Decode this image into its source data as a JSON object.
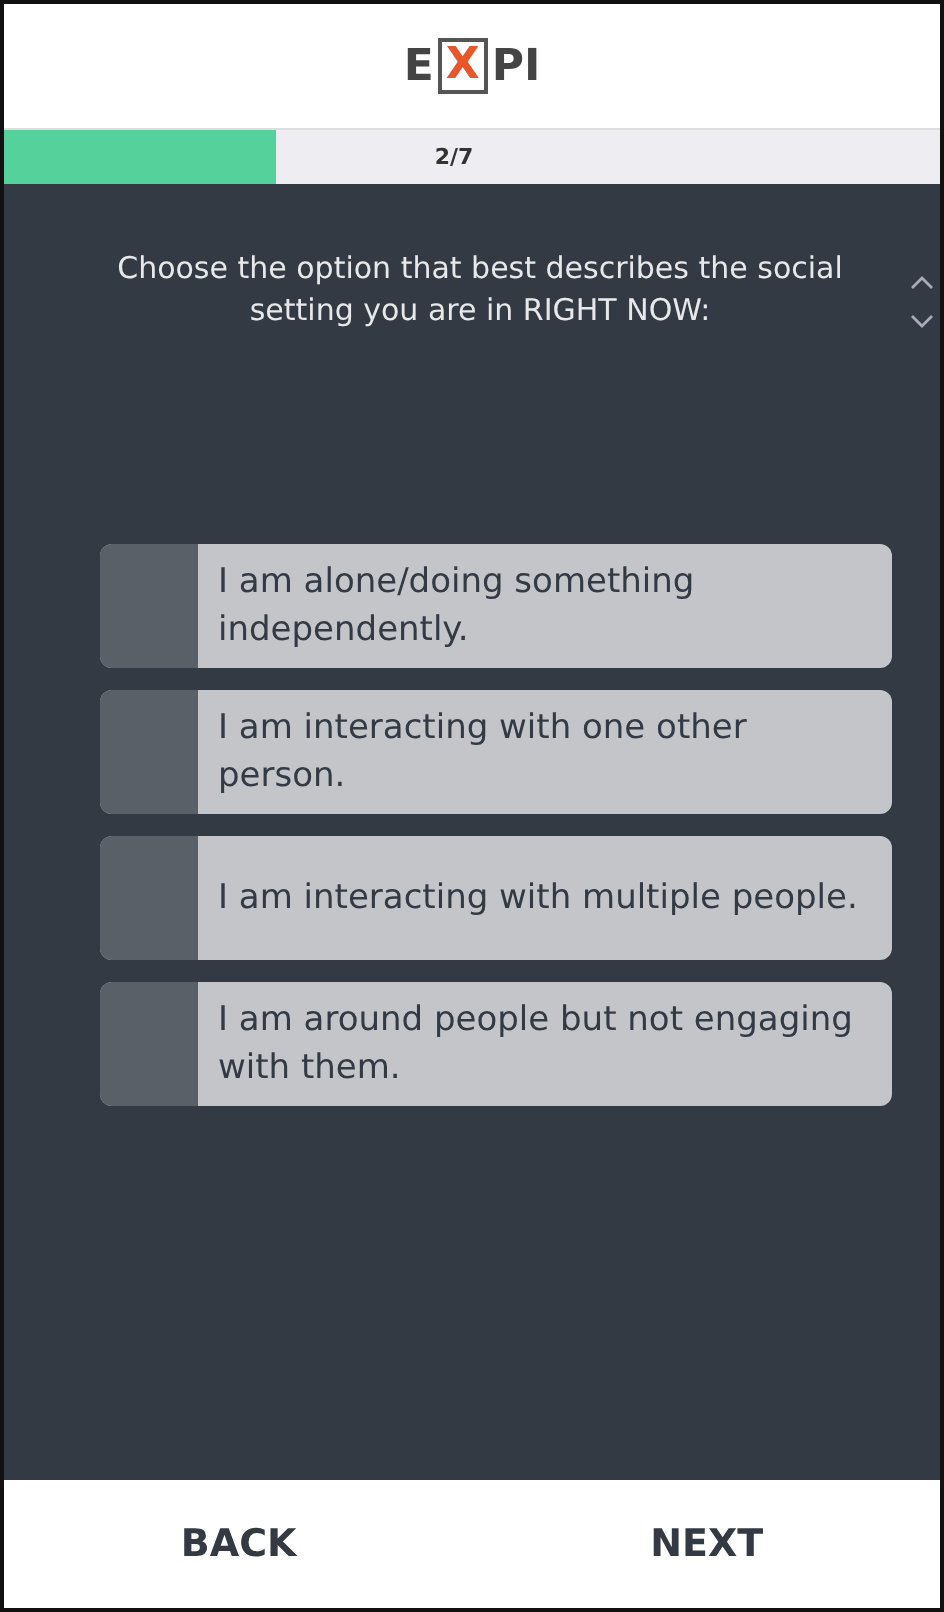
{
  "logo": {
    "parts": [
      {
        "text": "E",
        "boxed": false
      },
      {
        "text": "X",
        "boxed": true
      },
      {
        "text": "PI",
        "boxed": false
      }
    ]
  },
  "progress": {
    "level": 0.29,
    "label": "2/7"
  },
  "question": "Choose the option that best describes the social setting you are in RIGHT NOW:",
  "options": [
    {
      "label": "I am alone/doing something independently.",
      "selected": false
    },
    {
      "label": "I am interacting with one other person.",
      "selected": false
    },
    {
      "label": "I am interacting with multiple people.",
      "selected": false
    },
    {
      "label": "I am around people but not engaging with them.",
      "selected": false
    }
  ],
  "buttons": [
    "BACK",
    "NEXT"
  ]
}
